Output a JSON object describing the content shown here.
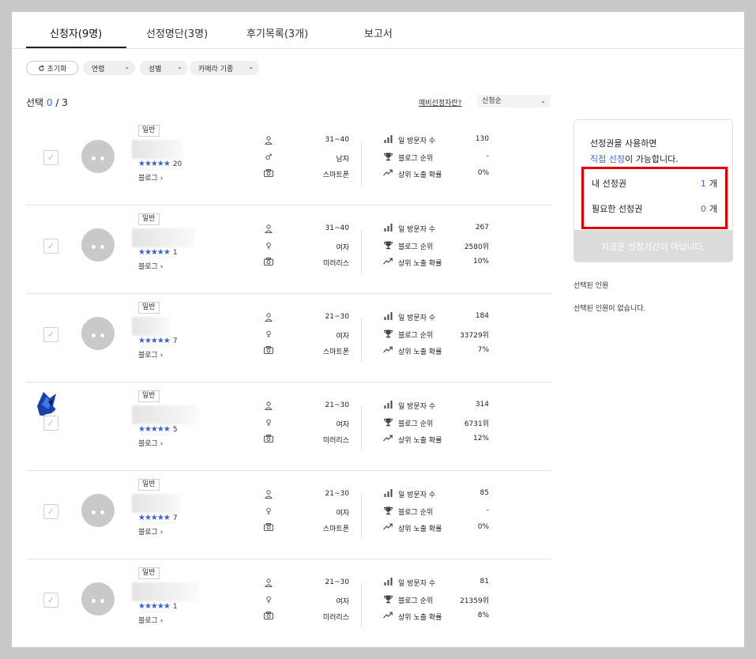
{
  "tabs": [
    {
      "label": "신청자(9명)"
    },
    {
      "label": "선정명단(3명)"
    },
    {
      "label": "후기목록(3개)"
    },
    {
      "label": "보고서"
    }
  ],
  "filters": {
    "reset_label": "초기화",
    "age_label": "연령",
    "gender_label": "성별",
    "camera_label": "카메라 기종"
  },
  "selection": {
    "prefix": "선택",
    "selected": "0",
    "separator": " / ",
    "total": "3"
  },
  "prelim_link": "예비선정자란?",
  "sort": {
    "selected": "신청순"
  },
  "icons": {
    "reset": "refresh-icon",
    "chevron": "chevron-down-icon",
    "checkbox": "check-icon",
    "person": "person-icon",
    "male": "male-icon",
    "female": "female-icon",
    "camera": "camera-icon",
    "visitors": "bar-chart-icon",
    "rank": "trophy-icon",
    "exposure": "trend-up-icon"
  },
  "labels": {
    "visitors": "일 방문자 수",
    "rank": "블로그 순위",
    "exposure": "상위 노출 확률",
    "blog": "블로그 ›",
    "stars": "★★★★★"
  },
  "applicants": [
    {
      "badge": "일반",
      "reviews": "20",
      "age": "31~40",
      "gender": "남자",
      "gender_icon": "male",
      "camera": "스마트폰",
      "visitors": "130",
      "rank": "-",
      "exposure": "0%",
      "photo": false
    },
    {
      "badge": "일반",
      "reviews": "1",
      "age": "31~40",
      "gender": "여자",
      "gender_icon": "female",
      "camera": "미러리스",
      "visitors": "267",
      "rank": "2580위",
      "exposure": "10%",
      "photo": false
    },
    {
      "badge": "일반",
      "reviews": "7",
      "age": "21~30",
      "gender": "여자",
      "gender_icon": "female",
      "camera": "스마트폰",
      "visitors": "184",
      "rank": "33729위",
      "exposure": "7%",
      "photo": false
    },
    {
      "badge": "일반",
      "reviews": "5",
      "age": "21~30",
      "gender": "여자",
      "gender_icon": "female",
      "camera": "미러리스",
      "visitors": "314",
      "rank": "6731위",
      "exposure": "12%",
      "photo": true
    },
    {
      "badge": "일반",
      "reviews": "7",
      "age": "21~30",
      "gender": "여자",
      "gender_icon": "female",
      "camera": "스마트폰",
      "visitors": "85",
      "rank": "-",
      "exposure": "0%",
      "photo": false
    },
    {
      "badge": "일반",
      "reviews": "1",
      "age": "21~30",
      "gender": "여자",
      "gender_icon": "female",
      "camera": "미러리스",
      "visitors": "81",
      "rank": "21359위",
      "exposure": "8%",
      "photo": false
    }
  ],
  "panel": {
    "line1": "선정권을 사용하면",
    "line2_highlight": "직접 선정",
    "line2_rest": "이 가능합니다.",
    "my_label": "내 선정권",
    "my_count": "1",
    "needed_label": "필요한 선정권",
    "needed_count": "0",
    "unit": "개",
    "footer": "지금은 선정기간이 아닙니다."
  },
  "selected_section": {
    "title": "선택된 인원",
    "empty": "선택된 인원이 없습니다."
  }
}
